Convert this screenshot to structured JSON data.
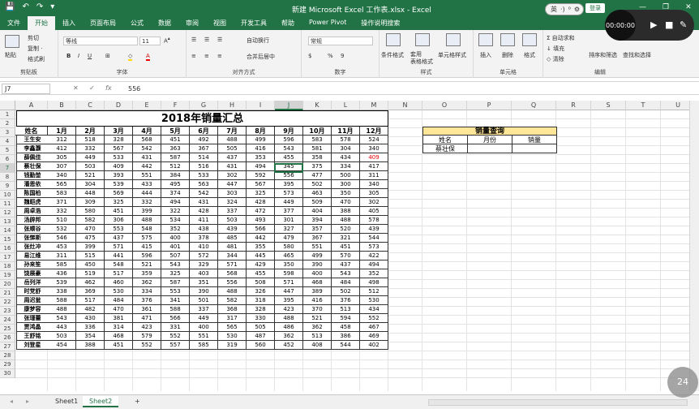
{
  "titlebar": {
    "save_icon": "save-icon",
    "undo": "↶",
    "redo": "↷",
    "title": "新建 Microsoft Excel 工作表.xlsx  -  Excel",
    "login": "登录",
    "minimize": "—",
    "restore": "❐",
    "close": "✕"
  },
  "ime": {
    "lang": "英",
    "sep": "·)",
    "punct": "⁰",
    "settings": "⚙"
  },
  "recorder": {
    "time": "00:00:00",
    "play": "▶",
    "stop": "■",
    "edit": "✎"
  },
  "tabs": [
    "文件",
    "开始",
    "插入",
    "页面布局",
    "公式",
    "数据",
    "审阅",
    "视图",
    "开发工具",
    "帮助",
    "Power Pivot",
    "操作说明搜索"
  ],
  "active_tab": "开始",
  "ribbon": {
    "paste": "粘贴",
    "cut": "剪切",
    "copy": "复制 ·",
    "painter": "格式刷",
    "clip_label": "剪贴板",
    "font_name": "等线",
    "font_size": "11",
    "font_label": "字体",
    "bold": "B",
    "italic": "I",
    "underline": "U",
    "wrap": "自动换行",
    "merge": "合并后居中",
    "align_label": "对齐方式",
    "number_format": "常规",
    "percent": "%",
    "comma": "9",
    "number_label": "数字",
    "cond": "条件格式",
    "table": "套用\n表格格式",
    "cellstyle": "单元格样式",
    "style_label": "样式",
    "insert": "插入",
    "delete": "删除",
    "format": "格式",
    "cells_label": "单元格",
    "autosum": "自动求和",
    "fill": "填充",
    "clear": "清除",
    "sort": "排序和筛选",
    "find": "查找和选择",
    "edit_label": "编辑"
  },
  "formula": {
    "namebox": "J7",
    "cancel": "✕",
    "enter": "✓",
    "fx": "fx",
    "value": "556"
  },
  "columns": [
    "A",
    "B",
    "C",
    "D",
    "E",
    "F",
    "G",
    "H",
    "I",
    "J",
    "K",
    "L",
    "M",
    "N",
    "O",
    "P",
    "Q",
    "R",
    "S",
    "T",
    "U"
  ],
  "rows": [
    "1",
    "2",
    "3",
    "4",
    "5",
    "6",
    "7",
    "8",
    "9",
    "10",
    "11",
    "12",
    "13",
    "14",
    "15",
    "16",
    "17",
    "18",
    "19",
    "20",
    "21",
    "22",
    "23",
    "24",
    "25",
    "26",
    "27",
    "28",
    "29",
    "30"
  ],
  "sheet_title": "2018年销量汇总",
  "headers": [
    "姓名",
    "1月",
    "2月",
    "3月",
    "4月",
    "5月",
    "6月",
    "7月",
    "8月",
    "9月",
    "10月",
    "11月",
    "12月"
  ],
  "names": [
    "王生安",
    "李鑫灏",
    "薛佩佳",
    "蔡壮保",
    "钱勤堃",
    "潘恩依",
    "陈国柏",
    "魏皑虎",
    "周卓浩",
    "汤辟邦",
    "张顺谷",
    "张悌斯",
    "张灶冲",
    "易江维",
    "孙来笙",
    "饶展豪",
    "岳列洋",
    "时党舒",
    "周迟瓮",
    "康梦容",
    "张瑾蕾",
    "贾鸿晶",
    "王舒铭",
    "刘登星"
  ],
  "values": [
    [
      312,
      518,
      328,
      568,
      451,
      492,
      488,
      499,
      596,
      583,
      578,
      524
    ],
    [
      412,
      332,
      567,
      542,
      363,
      367,
      505,
      416,
      543,
      581,
      304,
      340
    ],
    [
      305,
      449,
      533,
      431,
      587,
      514,
      437,
      353,
      455,
      358,
      434,
      409
    ],
    [
      307,
      503,
      409,
      442,
      512,
      516,
      431,
      494,
      345,
      375,
      334,
      417
    ],
    [
      340,
      521,
      393,
      551,
      384,
      533,
      302,
      592,
      556,
      477,
      500,
      311
    ],
    [
      565,
      304,
      539,
      433,
      495,
      563,
      447,
      567,
      395,
      502,
      300,
      340
    ],
    [
      583,
      448,
      569,
      444,
      374,
      542,
      303,
      325,
      573,
      463,
      350,
      305
    ],
    [
      371,
      309,
      325,
      332,
      494,
      431,
      324,
      428,
      449,
      509,
      470,
      302
    ],
    [
      332,
      580,
      451,
      399,
      322,
      428,
      337,
      472,
      377,
      404,
      388,
      405
    ],
    [
      510,
      582,
      306,
      488,
      534,
      411,
      503,
      493,
      301,
      394,
      488,
      578
    ],
    [
      532,
      470,
      553,
      548,
      352,
      438,
      439,
      566,
      327,
      357,
      520,
      439
    ],
    [
      546,
      475,
      437,
      575,
      400,
      378,
      485,
      442,
      479,
      367,
      321,
      544
    ],
    [
      453,
      399,
      571,
      415,
      401,
      410,
      481,
      355,
      580,
      551,
      451,
      573
    ],
    [
      311,
      515,
      441,
      596,
      507,
      572,
      344,
      445,
      465,
      499,
      570,
      422
    ],
    [
      585,
      450,
      548,
      521,
      543,
      329,
      571,
      429,
      350,
      390,
      437,
      494
    ],
    [
      436,
      519,
      517,
      359,
      325,
      403,
      568,
      455,
      598,
      400,
      543,
      352
    ],
    [
      539,
      462,
      460,
      362,
      587,
      351,
      556,
      508,
      571,
      468,
      484,
      498
    ],
    [
      338,
      369,
      530,
      334,
      553,
      390,
      488,
      326,
      447,
      389,
      502,
      512
    ],
    [
      588,
      517,
      484,
      376,
      341,
      501,
      582,
      318,
      395,
      416,
      376,
      530
    ],
    [
      488,
      482,
      470,
      361,
      588,
      337,
      368,
      328,
      423,
      370,
      513,
      434
    ],
    [
      543,
      430,
      381,
      471,
      566,
      449,
      317,
      330,
      488,
      521,
      594,
      552
    ],
    [
      443,
      336,
      314,
      423,
      331,
      400,
      565,
      505,
      486,
      362,
      458,
      467
    ],
    [
      503,
      354,
      468,
      579,
      552,
      551,
      530,
      487,
      362,
      513,
      386,
      469
    ],
    [
      454,
      388,
      451,
      552,
      557,
      585,
      319,
      560,
      452,
      408,
      544,
      402
    ]
  ],
  "red_cell": {
    "row": 2,
    "col": 11,
    "color": "#ee0000"
  },
  "lookup": {
    "title": "销量查询",
    "h_name": "姓名",
    "h_month": "月份",
    "h_sales": "销量",
    "name_val": "蔡壮保"
  },
  "selected": {
    "col": "J",
    "row": "7"
  },
  "sheets": [
    "Sheet1",
    "Sheet2"
  ],
  "active_sheet": "Sheet2",
  "add_sheet": "+",
  "zoom": "24",
  "colors": {
    "accent": "#217346",
    "lookup_fill": "#ffe699"
  }
}
